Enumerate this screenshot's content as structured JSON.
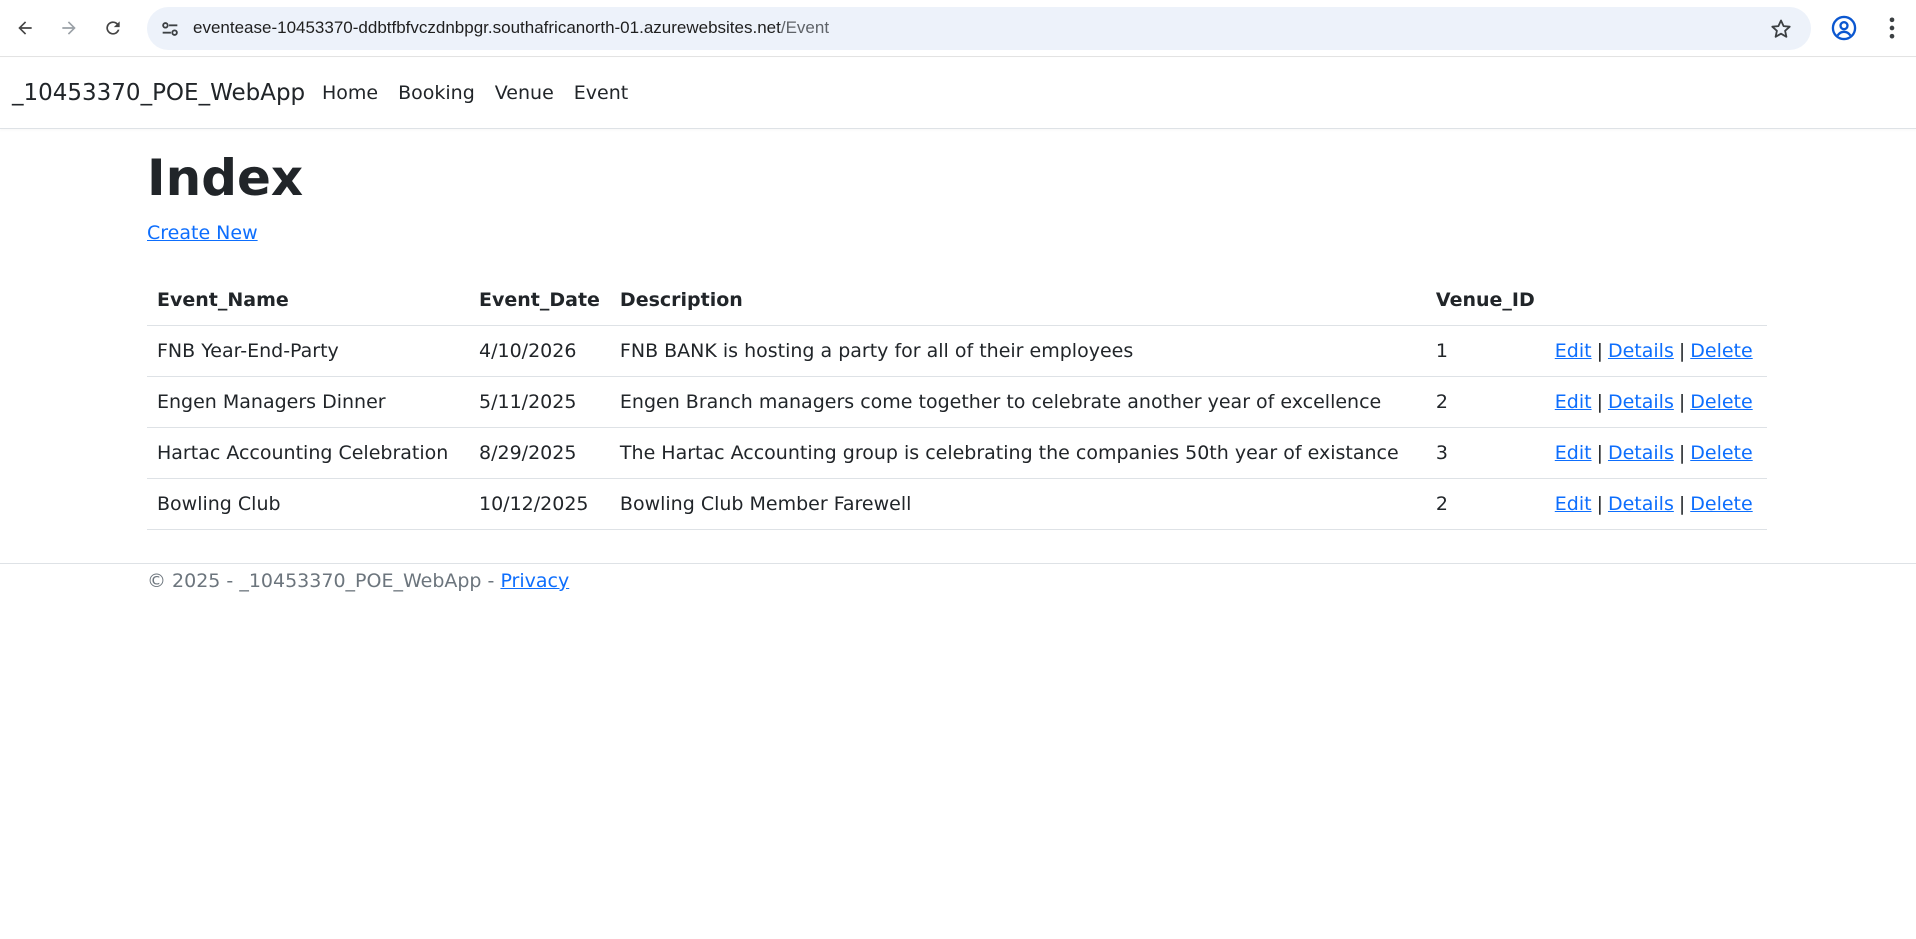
{
  "browser": {
    "url_host": "eventease-10453370-ddbtfbfvczdnbpgr.southafricanorth-01.azurewebsites.net",
    "url_path": "/Event",
    "icons": [
      "back-arrow-icon",
      "forward-arrow-icon",
      "reload-icon",
      "site-info-icon",
      "star-icon",
      "profile-icon",
      "menu-dots-icon"
    ]
  },
  "navbar": {
    "brand": "_10453370_POE_WebApp",
    "links": [
      "Home",
      "Booking",
      "Venue",
      "Event"
    ]
  },
  "page": {
    "title": "Index",
    "create_new": "Create New"
  },
  "table": {
    "headers": [
      "Event_Name",
      "Event_Date",
      "Description",
      "Venue_ID"
    ],
    "rows": [
      {
        "name": "FNB Year-End-Party",
        "date": "4/10/2026",
        "description": "FNB BANK is hosting a party for all of their employees",
        "venue_id": "1"
      },
      {
        "name": "Engen Managers Dinner",
        "date": "5/11/2025",
        "description": "Engen Branch managers come together to celebrate another year of excellence",
        "venue_id": "2"
      },
      {
        "name": "Hartac Accounting Celebration",
        "date": "8/29/2025",
        "description": "The Hartac Accounting group is celebrating the companies 50th year of existance",
        "venue_id": "3"
      },
      {
        "name": "Bowling Club",
        "date": "10/12/2025",
        "description": "Bowling Club Member Farewell",
        "venue_id": "2"
      }
    ],
    "actions": {
      "edit": "Edit",
      "details": "Details",
      "delete": "Delete",
      "separator": "|"
    }
  },
  "footer": {
    "text": "© 2025 - _10453370_POE_WebApp - ",
    "privacy": "Privacy"
  },
  "colors": {
    "link": "#0d6efd",
    "text": "#212529",
    "muted": "#6c757d",
    "omnibox_bg": "#edf2fa"
  }
}
